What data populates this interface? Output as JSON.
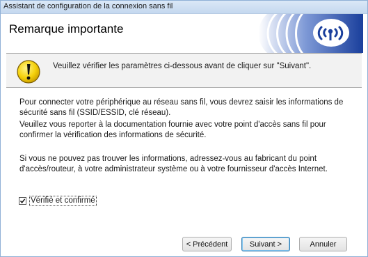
{
  "window": {
    "title": "Assistant de configuration de la connexion sans fil"
  },
  "header": {
    "heading": "Remarque importante"
  },
  "notice": {
    "message": "Veuillez vérifier les paramètres ci-dessous avant de cliquer sur \"Suivant\"."
  },
  "body": {
    "paragraph1": "Pour connecter votre périphérique au réseau sans fil, vous devrez saisir les informations de sécurité sans fil (SSID/ESSID, clé réseau).",
    "paragraph2": "Veuillez vous reporter à la documentation fournie avec votre point d'accès sans fil pour confirmer la vérification des informations de sécurité.",
    "paragraph3": "Si vous ne pouvez pas trouver les informations, adressez-vous au fabricant du point d'accès/routeur, à votre administrateur système ou à votre fournisseur d'accès Internet."
  },
  "confirm_checkbox": {
    "label": "Vérifié et confirmé",
    "checked": true
  },
  "buttons": {
    "back": "< Précédent",
    "next": "Suivant >",
    "cancel": "Annuler"
  },
  "icons": {
    "banner": "wifi-signal-icon",
    "notice": "warning-icon",
    "checkbox": "checkmark-icon"
  },
  "colors": {
    "banner_blue": "#1a3f9c",
    "warning_yellow": "#f5d10a"
  }
}
